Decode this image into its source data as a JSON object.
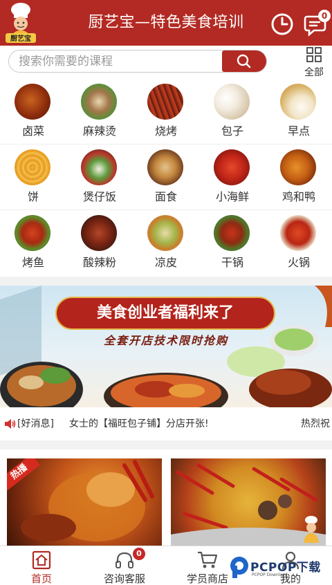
{
  "header": {
    "title": "厨艺宝—特色美食培训",
    "logo_text": "厨艺宝",
    "message_badge": "0"
  },
  "search": {
    "placeholder": "搜索你需要的课程",
    "all_label": "全部"
  },
  "categories": [
    [
      {
        "label": "卤菜"
      },
      {
        "label": "麻辣烫"
      },
      {
        "label": "烧烤"
      },
      {
        "label": "包子"
      },
      {
        "label": "早点"
      }
    ],
    [
      {
        "label": "饼"
      },
      {
        "label": "煲仔饭"
      },
      {
        "label": "面食"
      },
      {
        "label": "小海鲜"
      },
      {
        "label": "鸡和鸭"
      }
    ],
    [
      {
        "label": "烤鱼"
      },
      {
        "label": "酸辣粉"
      },
      {
        "label": "凉皮"
      },
      {
        "label": "干锅"
      },
      {
        "label": "火锅"
      }
    ]
  ],
  "banner": {
    "title": "美食创业者福利来了",
    "subtitle": "全套开店技术限时抢购"
  },
  "news": {
    "tag": "[好消息]",
    "text": "女士的【福旺包子铺】分店开张!",
    "text2": "热烈祝"
  },
  "cards": {
    "hot_label": "热播"
  },
  "tabbar": {
    "items": [
      {
        "label": "首页",
        "active": true
      },
      {
        "label": "咨询客服",
        "badge": "0"
      },
      {
        "label": "学员商店"
      },
      {
        "label": "我的"
      }
    ]
  },
  "watermark": {
    "text": "PCPOP下载",
    "small": "PCPOP Download"
  },
  "colors": {
    "brand": "#b22a23",
    "background": "#f2f2f2"
  }
}
